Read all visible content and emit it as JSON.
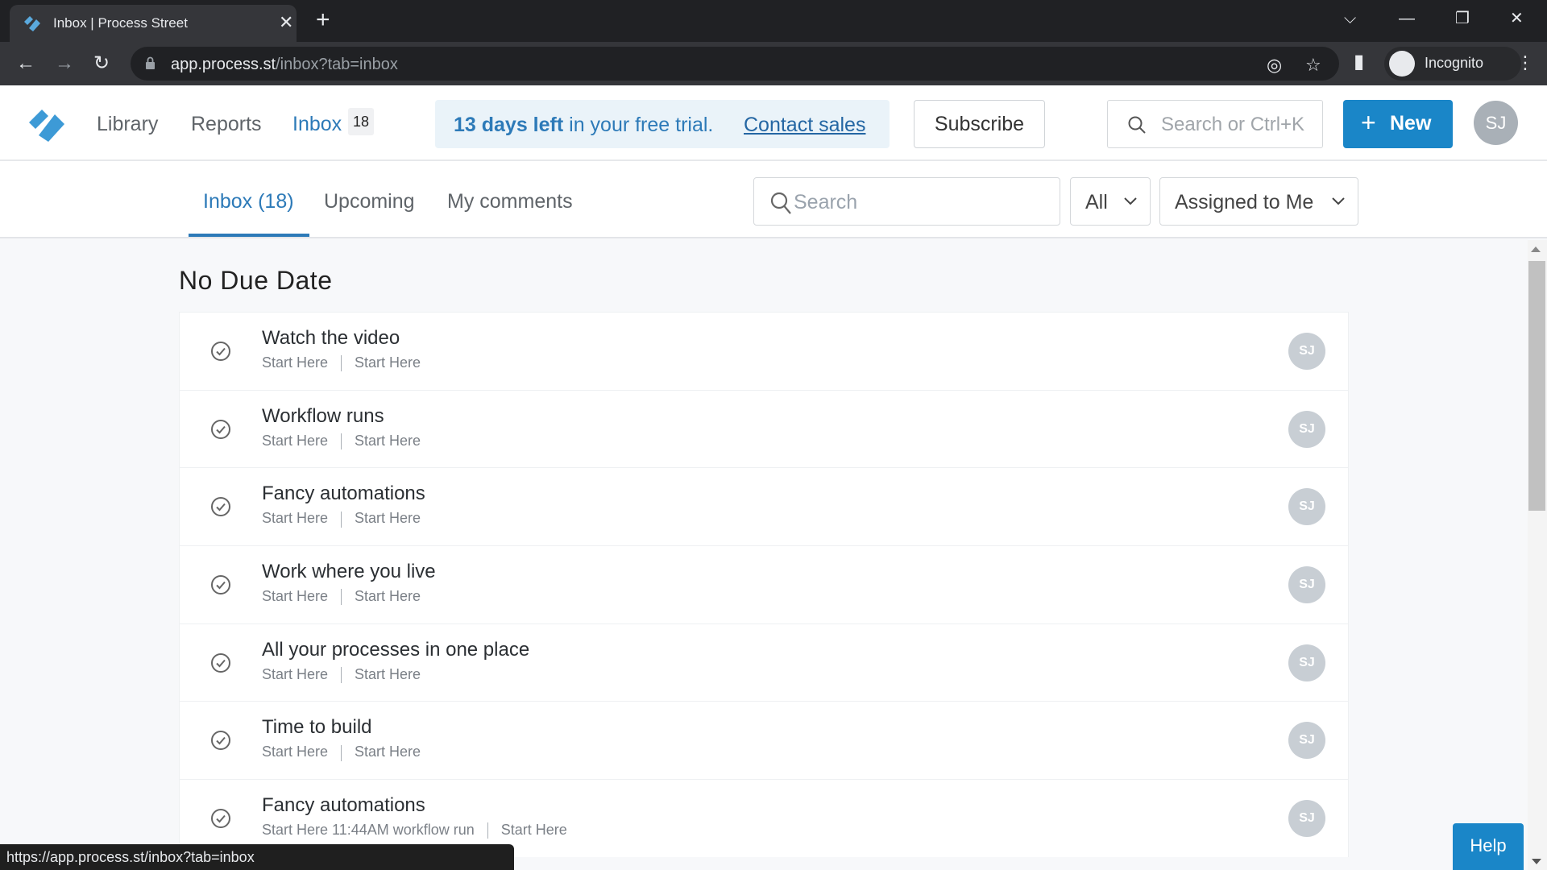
{
  "browser": {
    "tab_title": "Inbox | Process Street",
    "url_host": "app.process.st",
    "url_path": "/inbox?tab=inbox",
    "profile_label": "Incognito",
    "status_url": "https://app.process.st/inbox?tab=inbox"
  },
  "header": {
    "nav": [
      {
        "label": "Library"
      },
      {
        "label": "Reports"
      },
      {
        "label": "Inbox",
        "badge": "18",
        "active": true
      }
    ],
    "trial": {
      "days_left": "13 days left",
      "message_rest": " in your free trial.",
      "contact_label": "Contact sales"
    },
    "subscribe_label": "Subscribe",
    "search_placeholder": "Search or Ctrl+K",
    "new_label": "New",
    "user_initials": "SJ"
  },
  "subnav": {
    "tabs": [
      {
        "label": "Inbox (18)",
        "active": true
      },
      {
        "label": "Upcoming"
      },
      {
        "label": "My comments"
      }
    ],
    "search_placeholder": "Search",
    "type_filter": "All",
    "assignee_filter": "Assigned to Me"
  },
  "section_title": "No Due Date",
  "items": [
    {
      "title": "Watch the video",
      "workflow_run": "Start Here",
      "workflow": "Start Here",
      "assignee": "SJ"
    },
    {
      "title": "Workflow runs",
      "workflow_run": "Start Here",
      "workflow": "Start Here",
      "assignee": "SJ"
    },
    {
      "title": "Fancy automations",
      "workflow_run": "Start Here",
      "workflow": "Start Here",
      "assignee": "SJ"
    },
    {
      "title": "Work where you live",
      "workflow_run": "Start Here",
      "workflow": "Start Here",
      "assignee": "SJ"
    },
    {
      "title": "All your processes in one place",
      "workflow_run": "Start Here",
      "workflow": "Start Here",
      "assignee": "SJ"
    },
    {
      "title": "Time to build",
      "workflow_run": "Start Here",
      "workflow": "Start Here",
      "assignee": "SJ"
    },
    {
      "title": "Fancy automations",
      "workflow_run": "Start Here 11:44AM workflow run",
      "workflow": "Start Here",
      "assignee": "SJ"
    }
  ],
  "help_label": "Help",
  "colors": {
    "brand": "#1a86c8",
    "link": "#2d7ab8",
    "trial_bg": "#eaf3f9",
    "avatar_bg": "#c8ced4"
  }
}
